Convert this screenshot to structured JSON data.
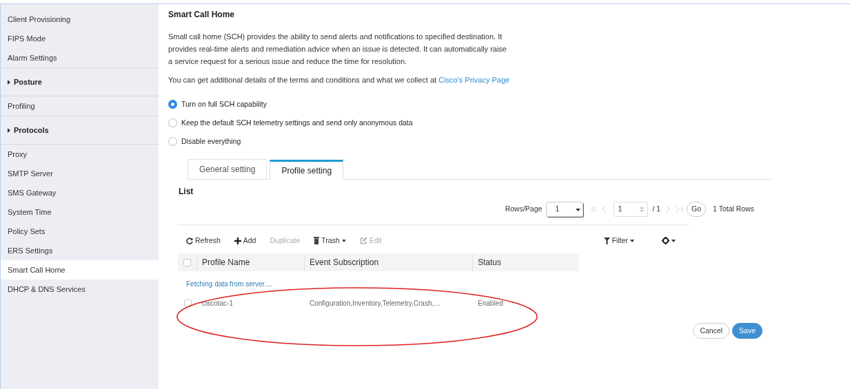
{
  "sidebar": {
    "items": [
      {
        "kind": "link",
        "label": "Client Provisioning",
        "selected": false
      },
      {
        "kind": "link",
        "label": "FIPS Mode",
        "selected": false
      },
      {
        "kind": "link",
        "label": "Alarm Settings",
        "selected": false
      },
      {
        "kind": "section",
        "label": "Posture",
        "expanded": false,
        "selected": false
      },
      {
        "kind": "link",
        "label": "Profiling",
        "selected": false
      },
      {
        "kind": "section",
        "label": "Protocols",
        "expanded": false,
        "selected": false
      },
      {
        "kind": "link",
        "label": "Proxy",
        "selected": false
      },
      {
        "kind": "link",
        "label": "SMTP Server",
        "selected": false
      },
      {
        "kind": "link",
        "label": "SMS Gateway",
        "selected": false
      },
      {
        "kind": "link",
        "label": "System Time",
        "selected": false
      },
      {
        "kind": "link",
        "label": "Policy Sets",
        "selected": false
      },
      {
        "kind": "link",
        "label": "ERS Settings",
        "selected": false
      },
      {
        "kind": "link",
        "label": "Smart Call Home",
        "selected": true
      },
      {
        "kind": "link",
        "label": "DHCP & DNS Services",
        "selected": false
      }
    ]
  },
  "page": {
    "title": "Smart Call Home",
    "description": "Small call home (SCH) provides the ability to send alerts and notifications to specified destination. It provides real-time alerts and remediation advice when an issue is detected. It can automatically raise a service request for a serious issue and reduce the time for resolution.",
    "privacy_text": "You can get additional details of the terms and conditions and what we collect at",
    "privacy_link": "Cisco's Privacy Page",
    "options": [
      {
        "label": "Turn on full SCH capability",
        "selected": true
      },
      {
        "label": "Keep the default SCH telemetry settings and send only anonymous data",
        "selected": false
      },
      {
        "label": "Disable everything",
        "selected": false
      }
    ],
    "tabs": [
      {
        "label": "General setting",
        "selected": false
      },
      {
        "label": "Profile setting",
        "selected": true
      }
    ],
    "list_title": "List",
    "pagination": {
      "rows_label": "Rows/Page",
      "rows_value": "1",
      "page_value": "1",
      "page_total": "/ 1",
      "go": "Go",
      "total": "1 Total Rows"
    },
    "toolbar": [
      {
        "kind": "refresh",
        "label": "Refresh",
        "disabled": false
      },
      {
        "kind": "add",
        "label": "Add",
        "disabled": false
      },
      {
        "kind": "plain",
        "label": "Duplicate",
        "disabled": true
      },
      {
        "kind": "trash",
        "label": "Trash",
        "disabled": false
      },
      {
        "kind": "edit",
        "label": "Edit",
        "disabled": true
      }
    ],
    "filter_label": "Filter",
    "table": {
      "all_checked": false,
      "columns": [
        "Profile Name",
        "Event Subscription",
        "Status"
      ],
      "status_message": "Fetching data from server....",
      "rows": [
        {
          "checked": false,
          "cells": [
            "ciscotac-1",
            "Configuration,Inventory,Telemetry,Crash,…",
            "Enabled"
          ]
        }
      ]
    },
    "buttons": [
      {
        "kind": "cancel",
        "label": "Cancel"
      },
      {
        "kind": "save",
        "label": "Save"
      }
    ]
  }
}
